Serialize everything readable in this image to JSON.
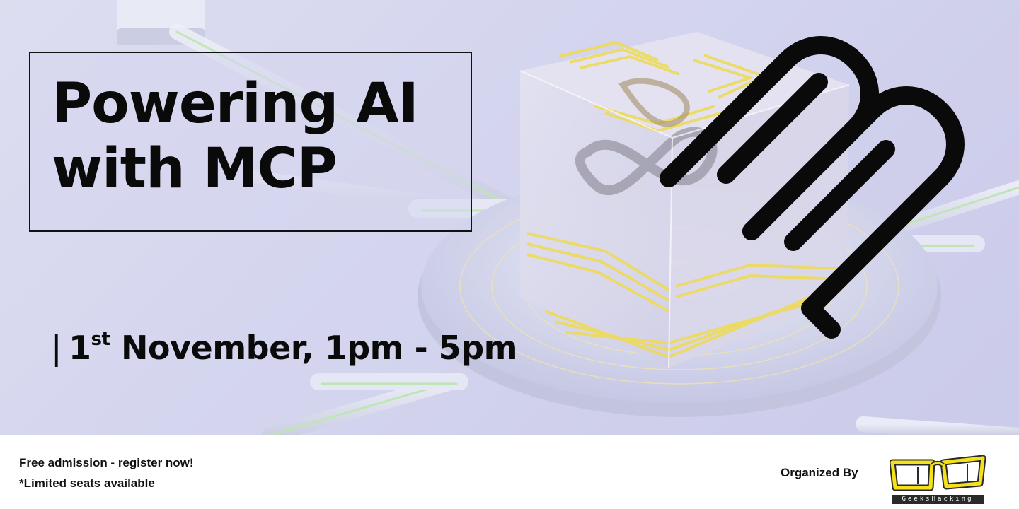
{
  "event": {
    "title_lines": [
      "Powering AI",
      "with MCP"
    ],
    "date": {
      "prefix": "|",
      "day": "1",
      "day_suffix": "st",
      "rest": "November, 1pm - 5pm"
    }
  },
  "footer": {
    "admission": "Free admission - register now!",
    "seats": "*Limited seats available",
    "organized_by": "Organized By",
    "organizer_wordmark": "GeeksHacking"
  },
  "icons": {
    "mcp_logo": "mcp-logo-icon",
    "organizer_logo": "geekshacking-glasses-logo",
    "hero": "glass-cube-infinity-illustration"
  },
  "colors": {
    "hero_background": "#d3d4ee",
    "text": "#0a0a0a",
    "accent_yellow": "#f2dc3a",
    "accent_green": "#b8eaa8",
    "logo_yellow": "#f5e11a"
  }
}
